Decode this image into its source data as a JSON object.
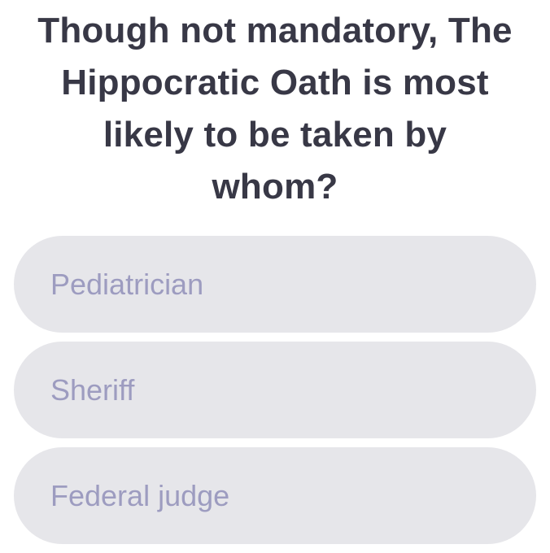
{
  "question": {
    "line1": "Though not mandatory, The",
    "line2": "Hippocratic Oath is most",
    "line3": "likely to be taken by",
    "line4": "whom?"
  },
  "answers": [
    {
      "label": "Pediatrician"
    },
    {
      "label": "Sheriff"
    },
    {
      "label": "Federal judge"
    }
  ],
  "colors": {
    "question_text": "#383846",
    "answer_background": "#e6e6ea",
    "answer_text": "#9d9cc0",
    "page_background": "#ffffff"
  }
}
